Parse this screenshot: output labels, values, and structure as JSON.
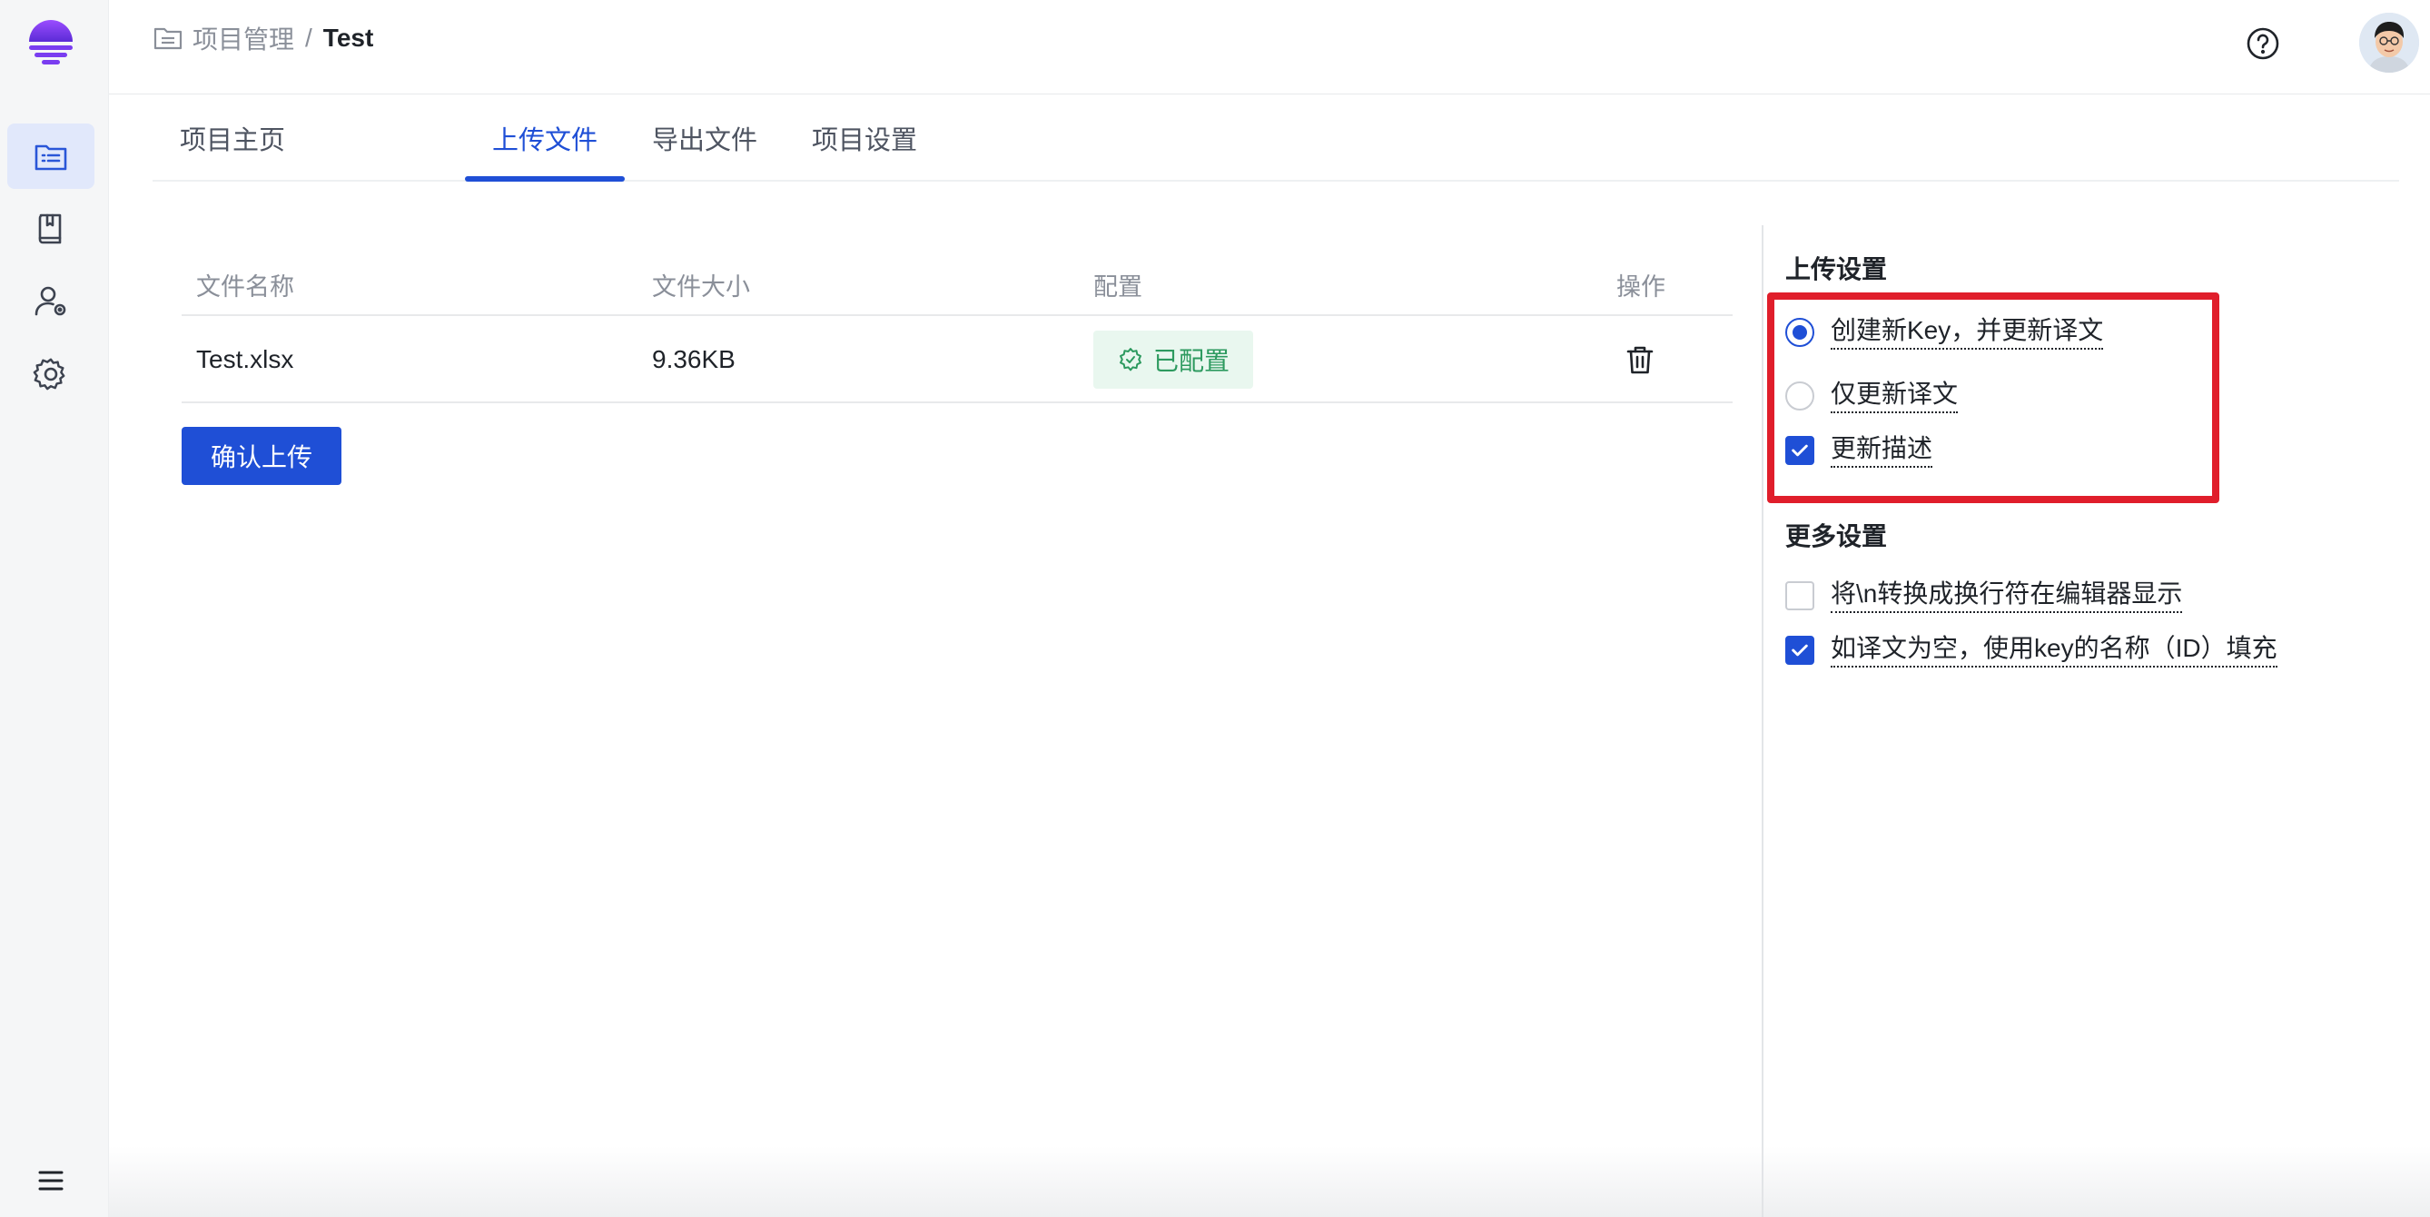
{
  "header": {
    "breadcrumb_parent": "项目管理",
    "breadcrumb_separator": "/",
    "breadcrumb_current": "Test"
  },
  "tabs": [
    {
      "label": "项目主页",
      "active": false
    },
    {
      "label": "上传文件",
      "active": true
    },
    {
      "label": "导出文件",
      "active": false
    },
    {
      "label": "项目设置",
      "active": false
    }
  ],
  "file_table": {
    "columns": [
      "文件名称",
      "文件大小",
      "配置",
      "操作"
    ],
    "rows": [
      {
        "name": "Test.xlsx",
        "size": "9.36KB",
        "config_status": "已配置"
      }
    ]
  },
  "confirm_button": "确认上传",
  "upload_settings": {
    "title": "上传设置",
    "mode_options": [
      {
        "label": "创建新Key，并更新译文",
        "checked": true
      },
      {
        "label": "仅更新译文",
        "checked": false
      }
    ],
    "update_description": {
      "label": "更新描述",
      "checked": true
    }
  },
  "more_settings": {
    "title": "更多设置",
    "options": [
      {
        "label": "将\\n转换成换行符在编辑器显示",
        "checked": false
      },
      {
        "label": "如译文为空，使用key的名称（ID）填充",
        "checked": true
      }
    ]
  },
  "colors": {
    "accent": "#1f4fd6",
    "highlight_box": "#e01e2b",
    "configured_text": "#2d9a5f",
    "configured_bg": "#e9f7ef"
  },
  "icons": {
    "sidebar": [
      "project-list-icon",
      "book-icon",
      "user-settings-icon",
      "gear-icon"
    ],
    "menu": "hamburger-menu-icon",
    "header": [
      "folder-icon",
      "help-icon"
    ],
    "row_actions": [
      "gear-check-icon",
      "trash-icon"
    ]
  }
}
